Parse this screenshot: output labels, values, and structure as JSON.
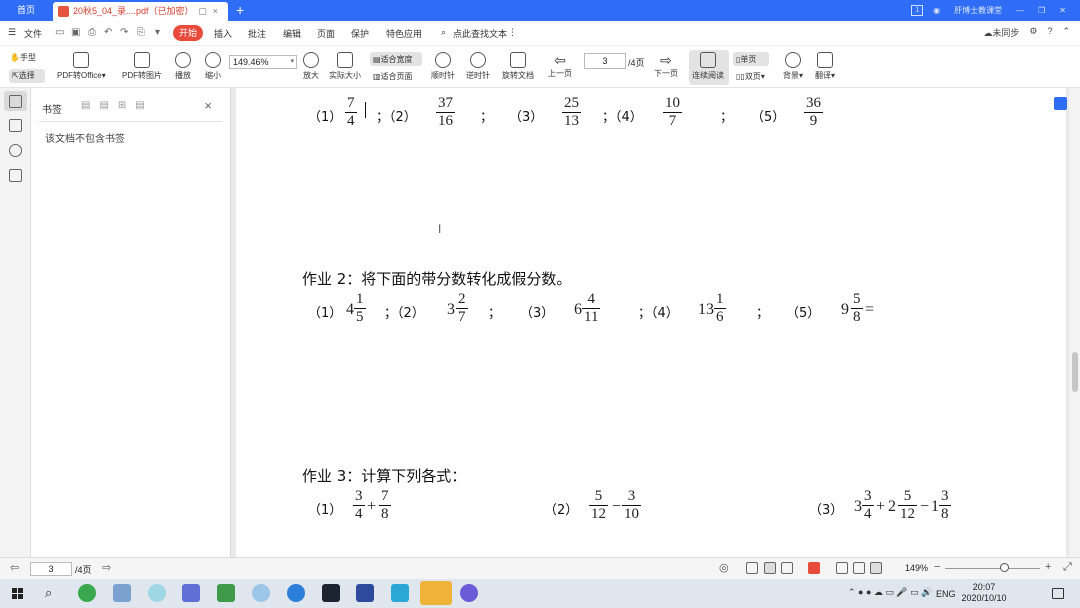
{
  "titlebar": {
    "home_tab": "首页",
    "doc_tab": "20秋5_04_录....pdf（已加密）",
    "add_tab": "+",
    "user_name": "肝博士教课堂",
    "badge": "1"
  },
  "menubar": {
    "file": "文件",
    "start": "开始",
    "insert": "插入",
    "annotate": "批注",
    "edit": "编辑",
    "page": "页面",
    "protect": "保护",
    "features": "特色应用",
    "search_placeholder": "点此查找文本",
    "sync": "未同步"
  },
  "toolbar": {
    "hand": "手型",
    "select": "选择",
    "pdf_to_office": "PDF转Office",
    "pdf_to_image": "PDF转图片",
    "play": "播放",
    "zoom_out": "缩小",
    "zoom_value": "149.46%",
    "zoom_in": "放大",
    "actual_size": "实际大小",
    "fit_width": "适合宽度",
    "fit_page": "适合页面",
    "rotate_cw": "顺时针",
    "rotate_ccw": "逆时针",
    "rotate_doc": "旋转文档",
    "prev_page": "上一页",
    "current_page": "3",
    "total_pages": "/4页",
    "next_page": "下一页",
    "continuous": "连续阅读",
    "single_page": "单页",
    "double_page": "双页",
    "background": "背景",
    "translate": "翻译"
  },
  "bookmark_panel": {
    "title": "书签",
    "empty_text": "该文档不包含书签"
  },
  "document": {
    "row1": {
      "labels": [
        "（1）",
        "；（2）",
        "；",
        "（3）",
        "；（4）",
        "；",
        "（5）"
      ],
      "fractions": [
        {
          "num": "7",
          "den": "4"
        },
        {
          "num": "37",
          "den": "16"
        },
        {
          "num": "25",
          "den": "13"
        },
        {
          "num": "10",
          "den": "7"
        },
        {
          "num": "36",
          "den": "9"
        }
      ]
    },
    "hw2": {
      "heading": "作业 2：将下面的带分数转化成假分数。",
      "labels": [
        "（1）",
        "；（2）",
        "；",
        "（3）",
        "；（4）",
        "；",
        "（5）"
      ],
      "mixed": [
        {
          "whole": "4",
          "num": "1",
          "den": "5"
        },
        {
          "whole": "3",
          "num": "2",
          "den": "7"
        },
        {
          "whole": "6",
          "num": "4",
          "den": "11"
        },
        {
          "whole": "13",
          "num": "1",
          "den": "6"
        },
        {
          "whole": "9",
          "num": "5",
          "den": "8"
        }
      ],
      "equals": "="
    },
    "hw3": {
      "heading": "作业 3：计算下列各式：",
      "labels": [
        "（1）",
        "（2）",
        "（3）"
      ],
      "ex1": {
        "a_num": "3",
        "a_den": "4",
        "op": "+",
        "b_num": "7",
        "b_den": "8"
      },
      "ex2": {
        "a_num": "5",
        "a_den": "12",
        "op": "−",
        "b_num": "3",
        "b_den": "10"
      },
      "ex3": {
        "w1": "3",
        "n1": "3",
        "d1": "4",
        "op1": "+",
        "w2": "2",
        "n2": "5",
        "d2": "12",
        "op2": "−",
        "w3": "1",
        "n3": "3",
        "d3": "8"
      }
    }
  },
  "statusbar": {
    "page_value": "3",
    "page_total": "/4页",
    "zoom": "149%",
    "minus": "−",
    "plus": "+"
  },
  "taskbar": {
    "lang": "ENG",
    "time": "20:07",
    "date": "2020/10/10"
  },
  "colors": {
    "accent": "#2f6df6",
    "start_button": "#e84a3b"
  }
}
